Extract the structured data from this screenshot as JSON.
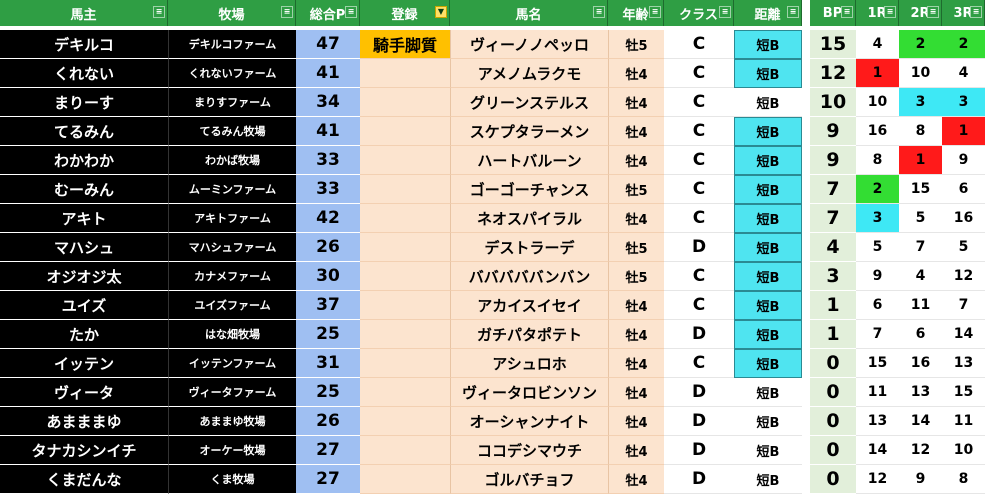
{
  "headers": {
    "owner": "馬主",
    "farm": "牧場",
    "total_points": "総合P",
    "registration": "登録",
    "horse": "馬名",
    "age": "年齢",
    "class": "クラス",
    "distance": "距離",
    "bp": "BP",
    "race1": "1R",
    "race2": "2R",
    "race3": "3R"
  },
  "colors": {
    "header": "#2f9e44",
    "owner_bg": "#000000",
    "points_bg": "#9fbff2",
    "entry_bg": "#fce4cf",
    "registration_tag": "#ffc000",
    "distance_highlight": "#4fe4f0",
    "bp_bg": "#e2efda",
    "rank_first": "#ff1a1a",
    "rank_second": "#33dd33",
    "rank_third": "#3ee8f5"
  },
  "rows": [
    {
      "owner": "デキルコ",
      "farm": "デキルコファーム",
      "points": "47",
      "registration": "騎手脚質",
      "horse": "ヴィーノノペッロ",
      "age": "牡5",
      "class": "C",
      "distance": "短B",
      "distance_highlight": true,
      "bp": "15",
      "r1": "4",
      "r2": "2",
      "r3": "2",
      "r1_mark": "",
      "r2_mark": "g",
      "r3_mark": "g"
    },
    {
      "owner": "くれない",
      "farm": "くれないファーム",
      "points": "41",
      "registration": "",
      "horse": "アメノムラクモ",
      "age": "牡4",
      "class": "C",
      "distance": "短B",
      "distance_highlight": true,
      "bp": "12",
      "r1": "1",
      "r2": "10",
      "r3": "4",
      "r1_mark": "r",
      "r2_mark": "",
      "r3_mark": ""
    },
    {
      "owner": "まりーす",
      "farm": "まりすファーム",
      "points": "34",
      "registration": "",
      "horse": "グリーンステルス",
      "age": "牡4",
      "class": "C",
      "distance": "短B",
      "distance_highlight": false,
      "bp": "10",
      "r1": "10",
      "r2": "3",
      "r3": "3",
      "r1_mark": "",
      "r2_mark": "c",
      "r3_mark": "c"
    },
    {
      "owner": "てるみん",
      "farm": "てるみん牧場",
      "points": "41",
      "registration": "",
      "horse": "スケプタラーメン",
      "age": "牡4",
      "class": "C",
      "distance": "短B",
      "distance_highlight": true,
      "bp": "9",
      "r1": "16",
      "r2": "8",
      "r3": "1",
      "r1_mark": "",
      "r2_mark": "",
      "r3_mark": "r"
    },
    {
      "owner": "わかわか",
      "farm": "わかば牧場",
      "points": "33",
      "registration": "",
      "horse": "ハートバルーン",
      "age": "牡4",
      "class": "C",
      "distance": "短B",
      "distance_highlight": true,
      "bp": "9",
      "r1": "8",
      "r2": "1",
      "r3": "9",
      "r1_mark": "",
      "r2_mark": "r",
      "r3_mark": ""
    },
    {
      "owner": "むーみん",
      "farm": "ムーミンファーム",
      "points": "33",
      "registration": "",
      "horse": "ゴーゴーチャンス",
      "age": "牡5",
      "class": "C",
      "distance": "短B",
      "distance_highlight": true,
      "bp": "7",
      "r1": "2",
      "r2": "15",
      "r3": "6",
      "r1_mark": "g",
      "r2_mark": "",
      "r3_mark": ""
    },
    {
      "owner": "アキト",
      "farm": "アキトファーム",
      "points": "42",
      "registration": "",
      "horse": "ネオスパイラル",
      "age": "牡4",
      "class": "C",
      "distance": "短B",
      "distance_highlight": true,
      "bp": "7",
      "r1": "3",
      "r2": "5",
      "r3": "16",
      "r1_mark": "c",
      "r2_mark": "",
      "r3_mark": ""
    },
    {
      "owner": "マハシュ",
      "farm": "マハシュファーム",
      "points": "26",
      "registration": "",
      "horse": "デストラーデ",
      "age": "牡5",
      "class": "D",
      "distance": "短B",
      "distance_highlight": true,
      "bp": "4",
      "r1": "5",
      "r2": "7",
      "r3": "5",
      "r1_mark": "",
      "r2_mark": "",
      "r3_mark": ""
    },
    {
      "owner": "オジオジ太",
      "farm": "カナメファーム",
      "points": "30",
      "registration": "",
      "horse": "バババババンバン",
      "age": "牡5",
      "class": "C",
      "distance": "短B",
      "distance_highlight": true,
      "bp": "3",
      "r1": "9",
      "r2": "4",
      "r3": "12",
      "r1_mark": "",
      "r2_mark": "",
      "r3_mark": ""
    },
    {
      "owner": "ユイズ",
      "farm": "ユイズファーム",
      "points": "37",
      "registration": "",
      "horse": "アカイスイセイ",
      "age": "牡4",
      "class": "C",
      "distance": "短B",
      "distance_highlight": true,
      "bp": "1",
      "r1": "6",
      "r2": "11",
      "r3": "7",
      "r1_mark": "",
      "r2_mark": "",
      "r3_mark": ""
    },
    {
      "owner": "たか",
      "farm": "はな畑牧場",
      "points": "25",
      "registration": "",
      "horse": "ガチパタポテト",
      "age": "牡4",
      "class": "D",
      "distance": "短B",
      "distance_highlight": true,
      "bp": "1",
      "r1": "7",
      "r2": "6",
      "r3": "14",
      "r1_mark": "",
      "r2_mark": "",
      "r3_mark": ""
    },
    {
      "owner": "イッテン",
      "farm": "イッテンファーム",
      "points": "31",
      "registration": "",
      "horse": "アシュロホ",
      "age": "牡4",
      "class": "C",
      "distance": "短B",
      "distance_highlight": true,
      "bp": "0",
      "r1": "15",
      "r2": "16",
      "r3": "13",
      "r1_mark": "",
      "r2_mark": "",
      "r3_mark": ""
    },
    {
      "owner": "ヴィータ",
      "farm": "ヴィータファーム",
      "points": "25",
      "registration": "",
      "horse": "ヴィータロビンソン",
      "age": "牡4",
      "class": "D",
      "distance": "短B",
      "distance_highlight": false,
      "bp": "0",
      "r1": "11",
      "r2": "13",
      "r3": "15",
      "r1_mark": "",
      "r2_mark": "",
      "r3_mark": ""
    },
    {
      "owner": "あまままゆ",
      "farm": "あままゆ牧場",
      "points": "26",
      "registration": "",
      "horse": "オーシャンナイト",
      "age": "牡4",
      "class": "D",
      "distance": "短B",
      "distance_highlight": false,
      "bp": "0",
      "r1": "13",
      "r2": "14",
      "r3": "11",
      "r1_mark": "",
      "r2_mark": "",
      "r3_mark": ""
    },
    {
      "owner": "タナカシンイチ",
      "farm": "オーケー牧場",
      "points": "27",
      "registration": "",
      "horse": "ココデシマウチ",
      "age": "牡4",
      "class": "D",
      "distance": "短B",
      "distance_highlight": false,
      "bp": "0",
      "r1": "14",
      "r2": "12",
      "r3": "10",
      "r1_mark": "",
      "r2_mark": "",
      "r3_mark": ""
    },
    {
      "owner": "くまだんな",
      "farm": "くま牧場",
      "points": "27",
      "registration": "",
      "horse": "ゴルバチョフ",
      "age": "牡4",
      "class": "D",
      "distance": "短B",
      "distance_highlight": false,
      "bp": "0",
      "r1": "12",
      "r2": "9",
      "r3": "8",
      "r1_mark": "",
      "r2_mark": "",
      "r3_mark": ""
    }
  ]
}
